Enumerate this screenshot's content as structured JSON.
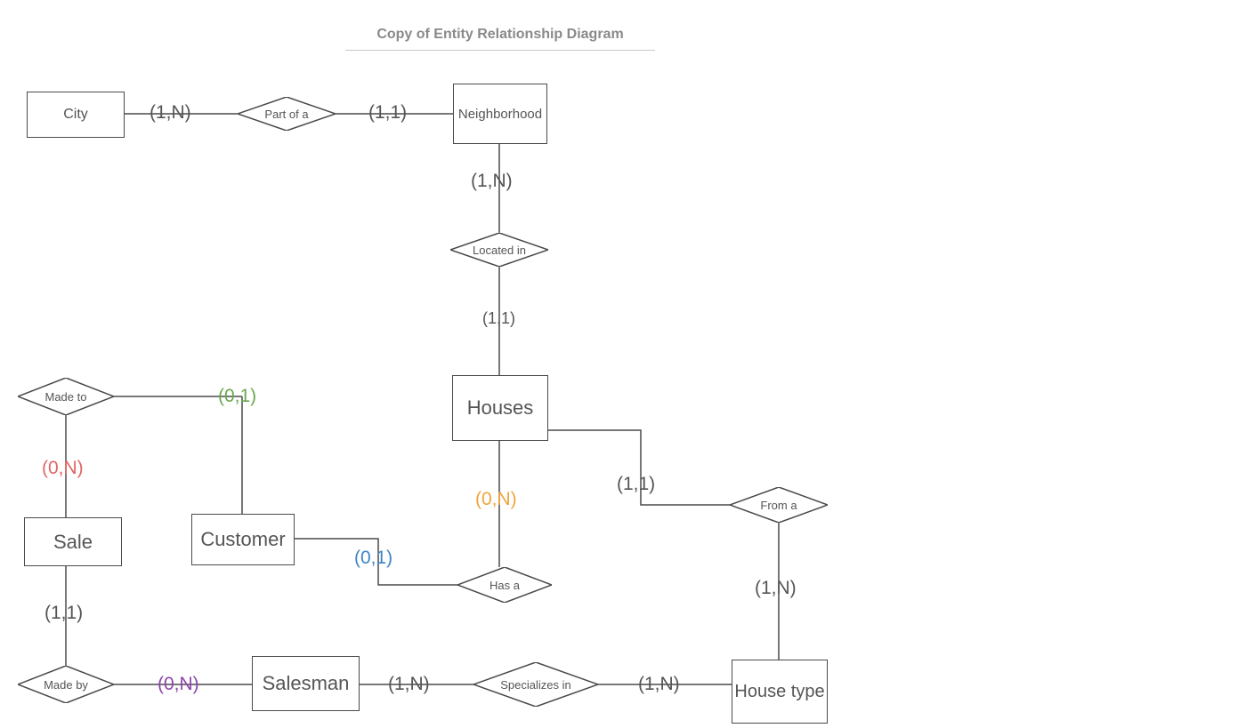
{
  "title": "Copy of  Entity Relationship Diagram",
  "entities": {
    "city": "City",
    "neighborhood": "Neighborhood",
    "houses": "Houses",
    "sale": "Sale",
    "customer": "Customer",
    "salesman": "Salesman",
    "house_type": "House type"
  },
  "relationships": {
    "part_of_a": "Part of a",
    "located_in": "Located in",
    "made_to": "Made to",
    "has_a": "Has a",
    "from_a": "From a",
    "made_by": "Made by",
    "specializes_in": "Specializes in"
  },
  "cardinalities": {
    "city_partof": "(1,N)",
    "neighborhood_partof": "(1,1)",
    "neighborhood_located": "(1,N)",
    "houses_located": "(1,1)",
    "houses_hasa": "(0,N)",
    "customer_hasa": "(0,1)",
    "customer_madeto": "(0,1)",
    "sale_madeto": "(0,N)",
    "sale_madeby": "(1,1)",
    "salesman_madeby": "(0,N)",
    "salesman_specializes": "(1,N)",
    "housetype_specializes": "(1,N)",
    "houses_froma": "(1,1)",
    "housetype_froma": "(1,N)"
  },
  "colors": {
    "default": "#555555",
    "green": "#6aa84f",
    "red": "#e06666",
    "blue": "#3d85c6",
    "orange": "#f1a33c",
    "purple": "#8e44ad"
  }
}
